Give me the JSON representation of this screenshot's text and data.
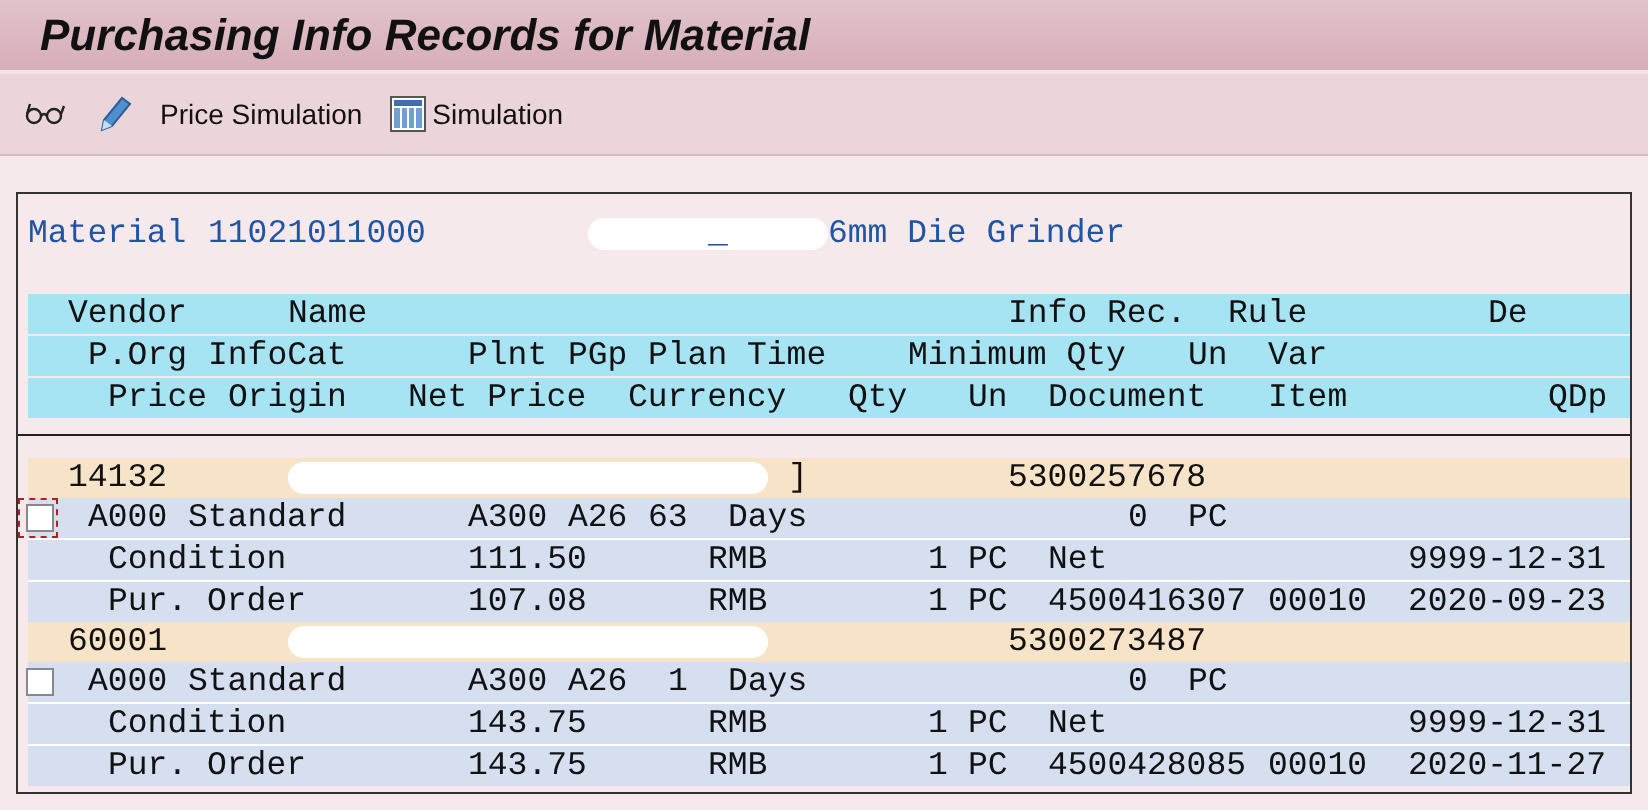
{
  "title": "Purchasing Info Records for Material",
  "toolbar": {
    "price_simulation": "Price Simulation",
    "simulation": "Simulation"
  },
  "material": {
    "label": "Material",
    "number": "11021011000",
    "mark": "_",
    "description": "6mm Die Grinder"
  },
  "header_lines": [
    [
      "Vendor",
      "Name",
      "Info Rec.",
      "Rule",
      "De"
    ],
    [
      "P.Org",
      "InfoCat",
      "Plnt",
      "PGp",
      "Plan Time",
      "Minimum Qty",
      "Un",
      "Var"
    ],
    [
      "Price",
      "Origin",
      "Net Price",
      "Currency",
      "Qty",
      "Un",
      "Document",
      "Item",
      "QDp"
    ]
  ],
  "vendors": [
    {
      "vendor": "14132",
      "name_tail": "]",
      "info_record": "5300257678",
      "checkbox": {
        "checked": false,
        "focused": true
      },
      "purch_org": "A000",
      "info_category": "Standard",
      "plant": "A300",
      "purch_group": "A26",
      "plan_time": "63",
      "time_unit": "Days",
      "minimum_qty": "0",
      "unit": "PC",
      "prices": [
        {
          "origin": "Condition",
          "net_price": "111.50",
          "currency": "RMB",
          "qty": "1",
          "unit": "PC",
          "document": "Net",
          "date": "9999-12-31"
        },
        {
          "origin": "Pur. Order",
          "net_price": "107.08",
          "currency": "RMB",
          "qty": "1",
          "unit": "PC",
          "document": "4500416307",
          "item": "00010",
          "date": "2020-09-23"
        }
      ]
    },
    {
      "vendor": "60001",
      "info_record": "5300273487",
      "checkbox": {
        "checked": false,
        "focused": false
      },
      "purch_org": "A000",
      "info_category": "Standard",
      "plant": "A300",
      "purch_group": "A26",
      "plan_time": "1",
      "time_unit": "Days",
      "minimum_qty": "0",
      "unit": "PC",
      "prices": [
        {
          "origin": "Condition",
          "net_price": "143.75",
          "currency": "RMB",
          "qty": "1",
          "unit": "PC",
          "document": "Net",
          "date": "9999-12-31"
        },
        {
          "origin": "Pur. Order",
          "net_price": "143.75",
          "currency": "RMB",
          "qty": "1",
          "unit": "PC",
          "document": "4500428085",
          "item": "00010",
          "date": "2020-11-27"
        }
      ]
    }
  ]
}
